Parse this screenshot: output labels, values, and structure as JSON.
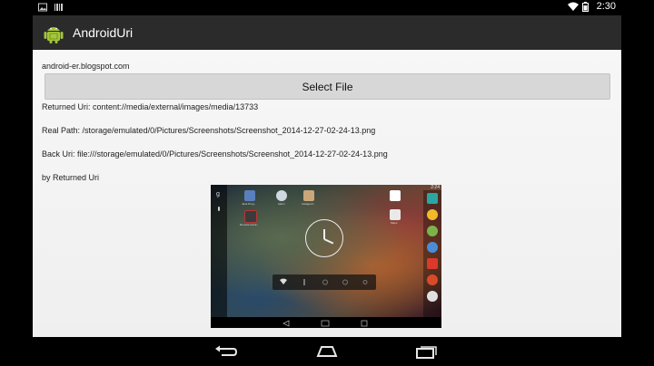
{
  "status_bar": {
    "time": "2:30"
  },
  "action_bar": {
    "title": "AndroidUri"
  },
  "main": {
    "blog_url": "android-er.blogspot.com",
    "select_button_label": "Select File",
    "returned_uri": "Returned Uri: content://media/external/images/media/13733",
    "real_path": "Real Path: /storage/emulated/0/Pictures/Screenshots/Screenshot_2014-12-27-02-24-13.png",
    "back_uri": "Back Uri: file:///storage/emulated/0/Pictures/Screenshots/Screenshot_2014-12-27-02-24-13.png",
    "by_label": "by Returned Uri"
  },
  "preview": {
    "time": "2:24",
    "apps": [
      "Java Prog...",
      "Alarm",
      "Instagram",
      "Remote Contr...",
      "Maps"
    ]
  },
  "colors": {
    "action_bar": "#2b2b2b",
    "content_bg": "#f4f4f4",
    "button_bg": "#d7d7d7",
    "android_green": "#a4c639"
  },
  "icons": [
    "image-icon",
    "barcode-icon",
    "wifi-icon",
    "battery-icon",
    "android-icon",
    "back-icon",
    "home-icon",
    "recents-icon"
  ]
}
